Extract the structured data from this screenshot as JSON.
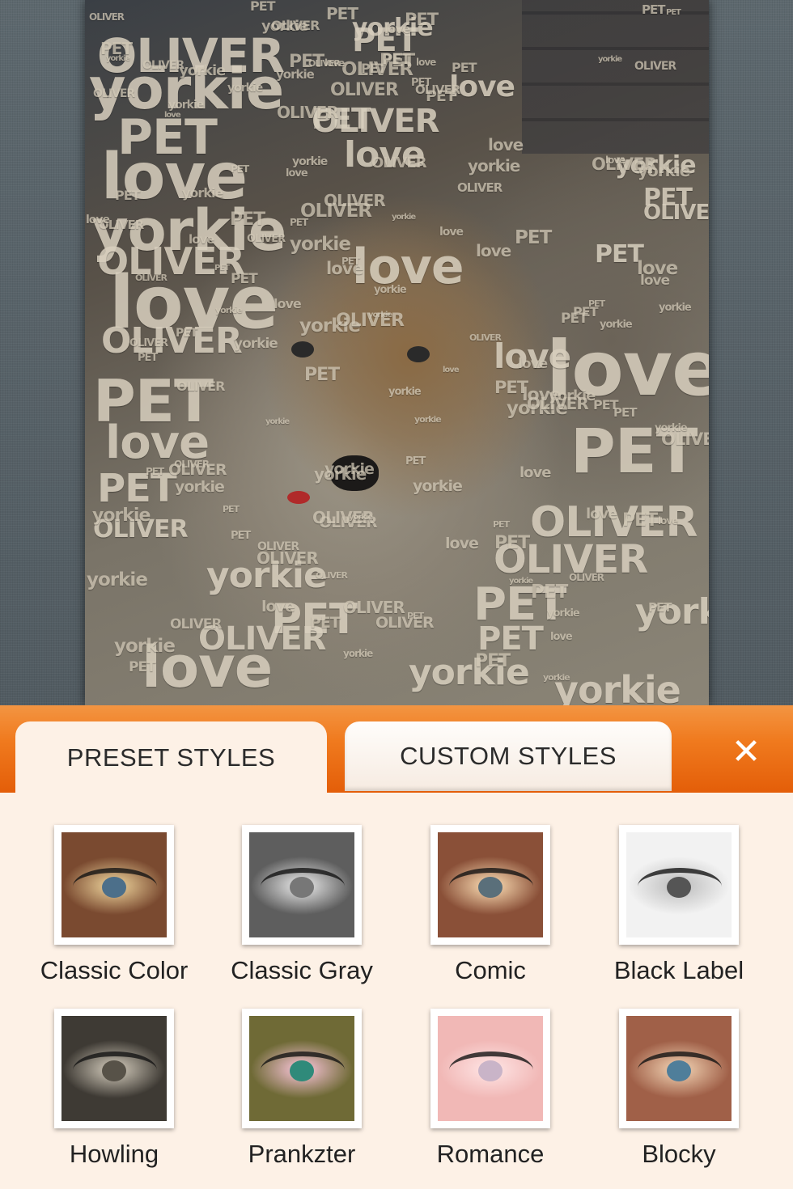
{
  "artwork": {
    "words": [
      "yorkie",
      "PET",
      "OLIVER",
      "love"
    ]
  },
  "tabs": {
    "preset": "PRESET STYLES",
    "custom": "CUSTOM STYLES",
    "active": "preset"
  },
  "close_icon": "close-icon",
  "styles": [
    {
      "label": "Classic Color",
      "thumb": {
        "bg": "#7a4a30",
        "iris": "#4c6f8a",
        "tx": "#f2d9a0"
      }
    },
    {
      "label": "Classic Gray",
      "thumb": {
        "bg": "#5e5e5e",
        "iris": "#777777",
        "tx": "#eeeeee"
      }
    },
    {
      "label": "Comic",
      "thumb": {
        "bg": "#8a5038",
        "iris": "#5a6f7a",
        "tx": "#ffe2b8"
      }
    },
    {
      "label": "Black Label",
      "thumb": {
        "bg": "#f2f2f2",
        "iris": "#555555",
        "tx": "#bbbbbb"
      }
    },
    {
      "label": "Howling",
      "thumb": {
        "bg": "#3e3a34",
        "iris": "#575248",
        "tx": "#d8d0c0"
      }
    },
    {
      "label": "Prankzter",
      "thumb": {
        "bg": "#6f6a36",
        "iris": "#2f8a7a",
        "tx": "#ffc8e0"
      }
    },
    {
      "label": "Romance",
      "thumb": {
        "bg": "#f1b8b6",
        "iris": "#c9b4c8",
        "tx": "#ffe6e6"
      }
    },
    {
      "label": "Blocky",
      "thumb": {
        "bg": "#a06048",
        "iris": "#4f7e9a",
        "tx": "#f5d8b8"
      }
    }
  ]
}
